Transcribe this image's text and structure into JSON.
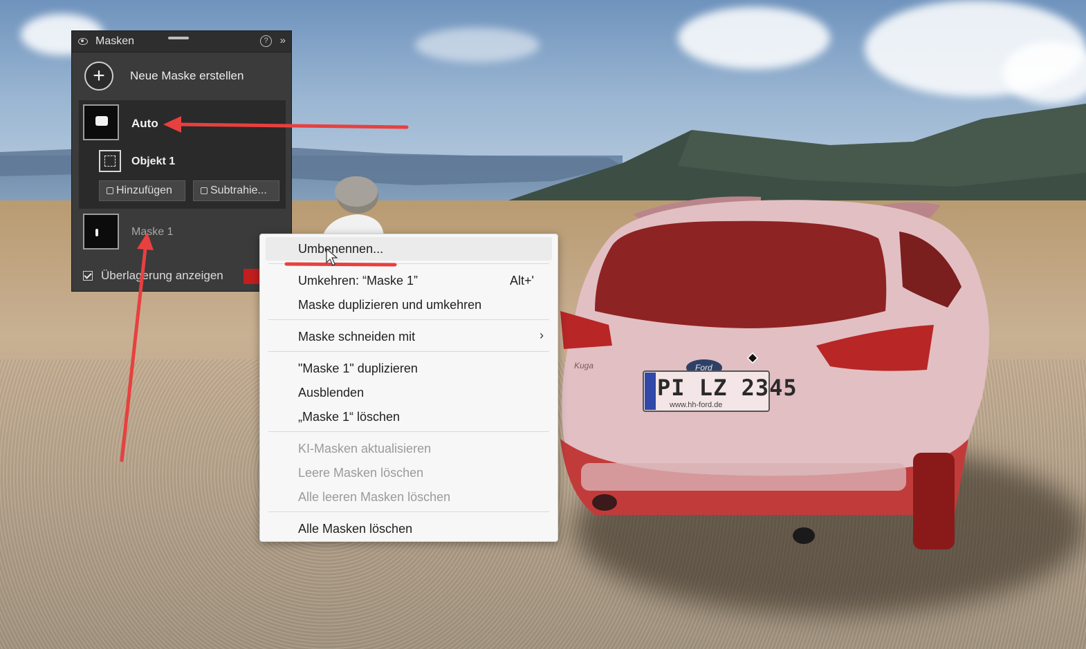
{
  "panel": {
    "title": "Masken",
    "help_glyph": "?",
    "expand_glyph": "»",
    "new_mask_label": "Neue Maske erstellen",
    "groups": [
      {
        "name": "Auto",
        "items": [
          {
            "name": "Objekt 1"
          }
        ],
        "buttons": {
          "add": "Hinzufügen",
          "subtract": "Subtrahie..."
        }
      },
      {
        "name": "Maske 1"
      }
    ],
    "overlay_label": "Überlagerung anzeigen",
    "overlay_checked": true,
    "overlay_color": "#c21e1e"
  },
  "context_menu": {
    "items": [
      {
        "label": "Umbenennen...",
        "enabled": true,
        "hovered": true
      },
      {
        "label": "Umkehren: “Maske 1”",
        "shortcut": "Alt+'",
        "enabled": true
      },
      {
        "label": "Maske duplizieren und umkehren",
        "enabled": true
      },
      {
        "label": "Maske schneiden mit",
        "submenu": true,
        "enabled": true
      },
      {
        "label": "\"Maske 1\" duplizieren",
        "enabled": true
      },
      {
        "label": "Ausblenden",
        "enabled": true
      },
      {
        "label": "„Maske 1“ löschen",
        "enabled": true
      },
      {
        "label": "KI-Masken aktualisieren",
        "enabled": false
      },
      {
        "label": "Leere Masken löschen",
        "enabled": false
      },
      {
        "label": "Alle leeren Masken löschen",
        "enabled": false
      },
      {
        "label": "Alle Masken löschen",
        "enabled": true
      }
    ],
    "submenu_glyph": "›"
  },
  "photo": {
    "license_plate": "PI LZ 2345",
    "dealer_text": "www.hh-ford.de",
    "brand_badge": "Ford",
    "model_badge": "Kuga"
  },
  "annotations": {
    "color": "#e8403f"
  }
}
